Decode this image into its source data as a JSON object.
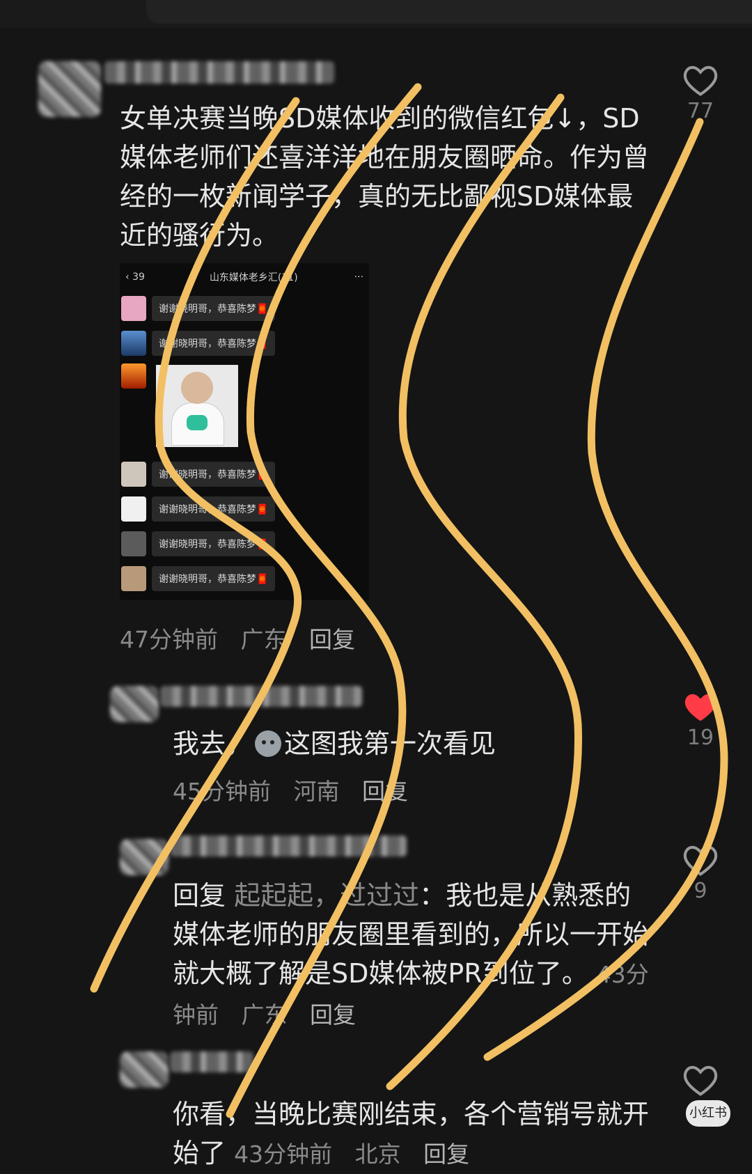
{
  "comments": [
    {
      "text": "女单决赛当晚SD媒体收到的微信红包↓，SD媒体老师们还喜洋洋地在朋友圈晒命。作为曾经的一枚新闻学子，真的无比鄙视SD媒体最近的骚行为。",
      "time": "47分钟前",
      "location": "广东",
      "reply": "回复",
      "likes": "77",
      "liked": false
    },
    {
      "text_before_emoji": "我去，",
      "text_after_emoji": "这图我第一次看见",
      "time": "45分钟前",
      "location": "河南",
      "reply": "回复",
      "likes": "19",
      "liked": true
    },
    {
      "reply_prefix": "回复",
      "reply_to": "起起起，过过过",
      "text": "：我也是从熟悉的媒体老师的朋友圈里看到的，所以一开始就大概了解是SD媒体被PR到位了。",
      "time": "43分钟前",
      "location": "广东",
      "reply": "回复",
      "likes": "9",
      "liked": false
    },
    {
      "text": "你看，当晚比赛刚结束，各个营销号就开始了",
      "time": "43分钟前",
      "location": "北京",
      "reply": "回复",
      "likes": "",
      "liked": false
    }
  ],
  "screenshot": {
    "back_count": "39",
    "title": "山东媒体老乡汇(31)",
    "more": "···",
    "message": "谢谢晓明哥，恭喜陈梦",
    "message_suffix": "🧧",
    "rows_before_sticker": 2,
    "rows_after_sticker": 4
  },
  "colors": {
    "background": "#151515",
    "scribble": "#f2c063",
    "like_red": "#ff3b47"
  },
  "watermark": "小红书"
}
